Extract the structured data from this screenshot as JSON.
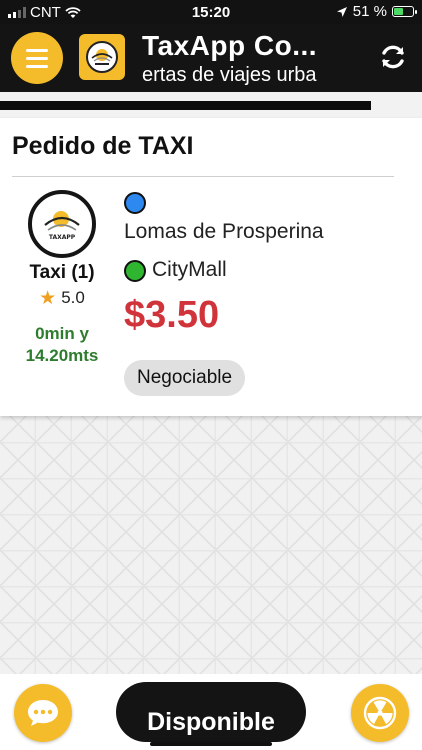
{
  "status_bar": {
    "carrier": "CNT",
    "time": "15:20",
    "battery": "51 %",
    "battery_level": 0.51
  },
  "header": {
    "title": "TaxApp Co...",
    "subtitle": "ertas de viajes urba",
    "menu_icon": "hamburger-icon",
    "refresh_icon": "refresh-icon",
    "logo_text": "TAXAPP"
  },
  "progress": {
    "level": 0.88
  },
  "card": {
    "title": "Pedido de TAXI",
    "driver": {
      "name": "Taxi (1)",
      "rating": "5.0",
      "eta_line1": "0min y",
      "eta_line2": "14.20mts"
    },
    "origin": "Lomas de Prosperina",
    "destination": "CityMall",
    "price": "$3.50",
    "badge": "Negociable"
  },
  "bottom": {
    "status_label": "Disponible",
    "chat_icon": "chat-icon",
    "radiation_icon": "radiation-icon"
  },
  "colors": {
    "accent": "#f4bc2b",
    "dark": "#141414",
    "price": "#d1333a",
    "eta": "#2e7d2e",
    "origin_dot": "#2d89ef",
    "dest_dot": "#2fb52f"
  }
}
